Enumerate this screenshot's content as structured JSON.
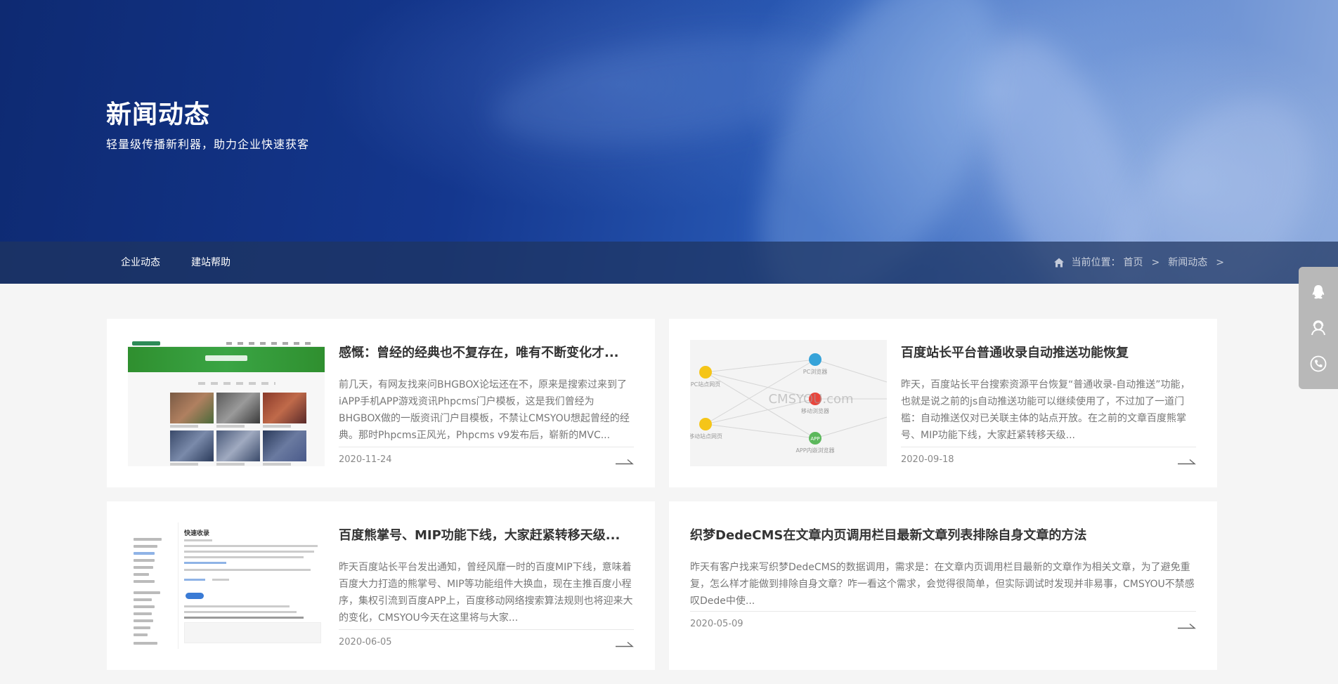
{
  "banner": {
    "title": "新闻动态",
    "subtitle": "轻量级传播新利器，助力企业快速获客"
  },
  "nav": {
    "items": [
      {
        "label": "企业动态"
      },
      {
        "label": "建站帮助"
      }
    ],
    "breadcrumb": {
      "prefix": "当前位置：",
      "home": "首页",
      "current": "新闻动态",
      "sep": ">"
    }
  },
  "articles": [
    {
      "title": "感慨：曾经的经典也不复存在，唯有不断变化才...",
      "desc": "前几天，有网友找来问BHGBOX论坛还在不，原来是搜索过来到了iAPP手机APP游戏资讯Phpcms门户模板，这是我们曾经为BHGBOX做的一版资讯门户目模板，不禁让CMSYOU想起曾经的经典。那时Phpcms正风光，Phpcms v9发布后，崭新的MVC...",
      "date": "2020-11-24"
    },
    {
      "title": "百度站长平台普通收录自动推送功能恢复",
      "desc": "昨天，百度站长平台搜索资源平台恢复“普通收录-自动推送”功能，也就是说之前的js自动推送功能可以继续使用了，不过加了一道门槛：自动推送仅对已关联主体的站点开放。在之前的文章百度熊掌号、MIP功能下线，大家赶紧转移天级...",
      "date": "2020-09-18",
      "thumb": {
        "watermark": "CMSYOU.com",
        "nodes": [
          "PC站点网页",
          "移动站点网页",
          "PC浏览器",
          "移动浏览器",
          "APP内嵌浏览器"
        ],
        "app_label": "APP"
      }
    },
    {
      "title": "百度熊掌号、MIP功能下线，大家赶紧转移天级...",
      "desc": "昨天百度站长平台发出通知，曾经风靡一时的百度MIP下线，意味着百度大力打造的熊掌号、MIP等功能组件大换血，现在主推百度小程序，集权引流到百度APP上，百度移动网络搜索算法规则也将迎来大的变化，CMSYOU今天在这里将与大家...",
      "date": "2020-06-05",
      "thumb": {
        "heading": "快速收录"
      }
    },
    {
      "title": "织梦DedeCMS在文章内页调用栏目最新文章列表排除自身文章的方法",
      "desc": "昨天有客户找来写织梦DedeCMS的数据调用，需求是：在文章内页调用栏目最新的文章作为相关文章，为了避免重复，怎么样才能做到排除自身文章？咋一看这个需求，会觉得很简单，但实际调试时发现并非易事，CMSYOU不禁感叹Dede中使...",
      "date": "2020-05-09"
    }
  ],
  "side_tools": [
    "qq-icon",
    "customer-service-icon",
    "phone-icon"
  ],
  "colors": {
    "banner_dark": "#0e2a72",
    "nav_bar": "#1e3460",
    "card_bg": "#ffffff",
    "page_bg": "#f5f5f5"
  }
}
